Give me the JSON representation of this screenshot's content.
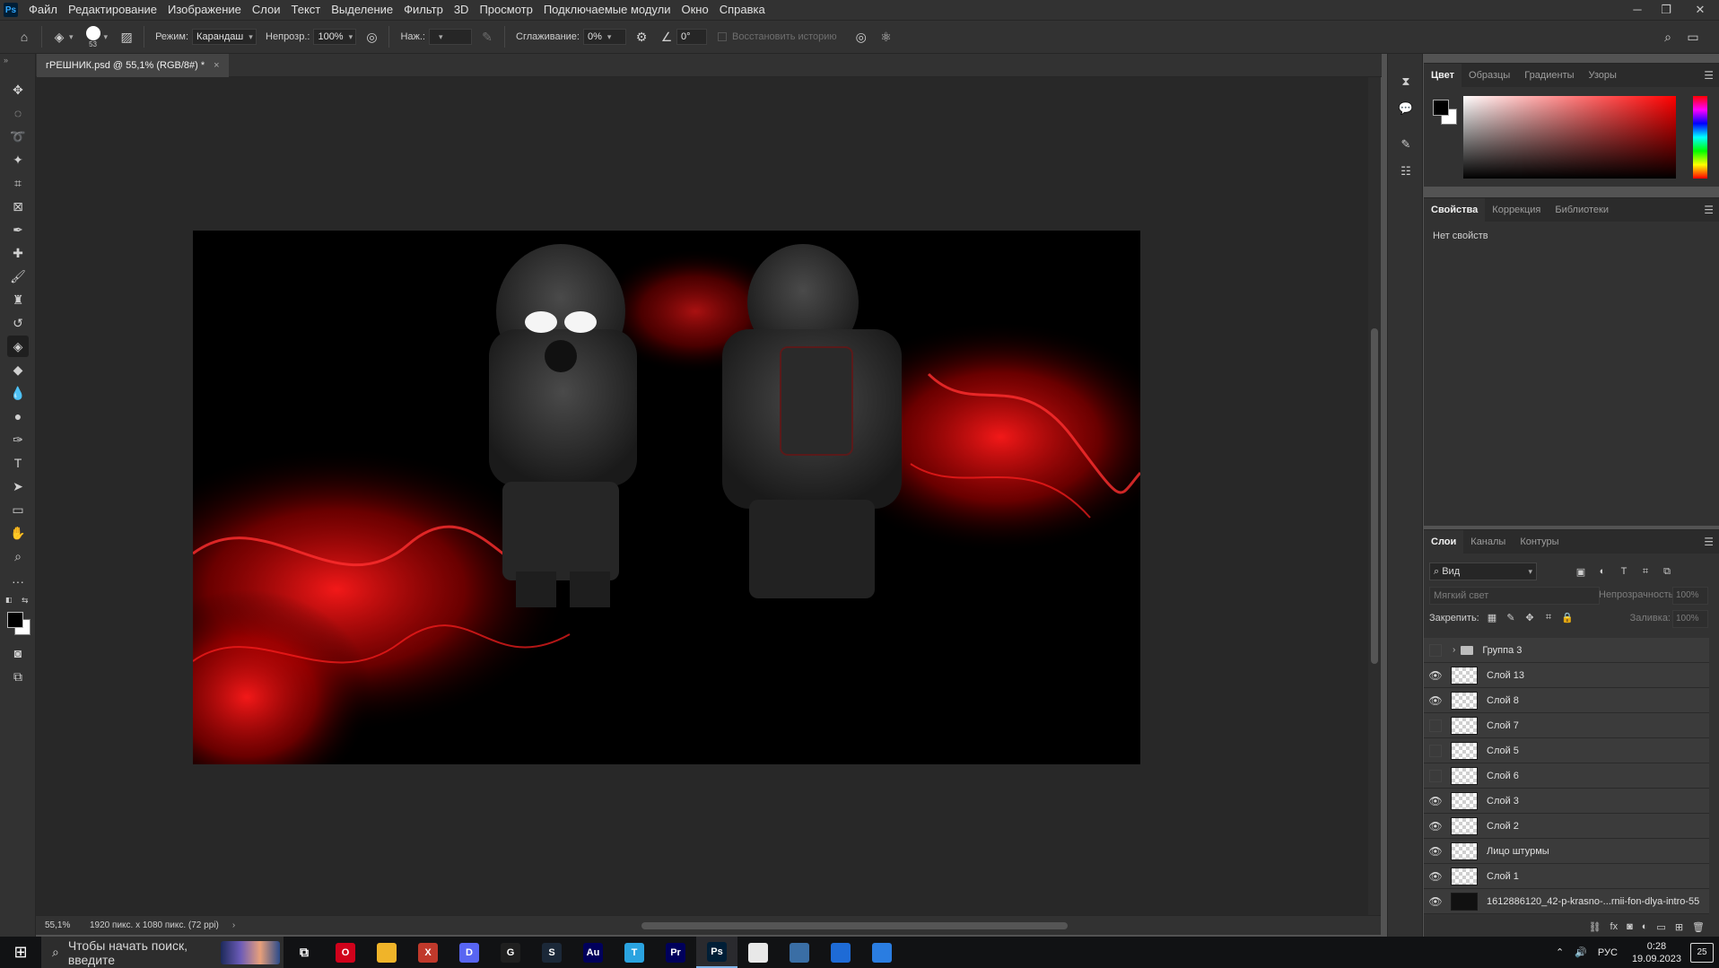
{
  "app": {
    "logo": "Ps"
  },
  "menu": [
    "Файл",
    "Редактирование",
    "Изображение",
    "Слои",
    "Текст",
    "Выделение",
    "Фильтр",
    "3D",
    "Просмотр",
    "Подключаемые модули",
    "Окно",
    "Справка"
  ],
  "options": {
    "brush_size": "53",
    "mode_label": "Режим:",
    "mode_value": "Карандаш",
    "opacity_label": "Непрозр.:",
    "opacity_value": "100%",
    "pressure_label": "Наж.:",
    "smoothing_label": "Сглаживание:",
    "smoothing_value": "0%",
    "angle_value": "0°",
    "restore_history": "Восстановить историю"
  },
  "document": {
    "tab_title": "гРЕШНИК.psd @ 55,1% (RGB/8#) *",
    "close_glyph": "×"
  },
  "status": {
    "zoom": "55,1%",
    "dimensions": "1920 пикс. x 1080 пикс. (72 ppi)"
  },
  "color_panel": {
    "tabs": [
      "Цвет",
      "Образцы",
      "Градиенты",
      "Узоры"
    ],
    "foreground": "#000000",
    "background": "#ffffff"
  },
  "properties_panel": {
    "tabs": [
      "Свойства",
      "Коррекция",
      "Библиотеки"
    ],
    "empty_text": "Нет свойств"
  },
  "layers_panel": {
    "tabs": [
      "Слои",
      "Каналы",
      "Контуры"
    ],
    "filter_value": "Вид",
    "blend_mode": "Мягкий свет",
    "opacity_label": "Непрозрачность:",
    "opacity_value": "100%",
    "lock_label": "Закрепить:",
    "fill_label": "Заливка:",
    "fill_value": "100%",
    "layers": [
      {
        "name": "Группа 3",
        "visible": false,
        "kind": "group"
      },
      {
        "name": "Слой 13",
        "visible": true,
        "kind": "layer"
      },
      {
        "name": "Слой 8",
        "visible": true,
        "kind": "layer"
      },
      {
        "name": "Слой 7",
        "visible": false,
        "kind": "layer"
      },
      {
        "name": "Слой 5",
        "visible": false,
        "kind": "layer"
      },
      {
        "name": "Слой 6",
        "visible": false,
        "kind": "layer"
      },
      {
        "name": "Слой 3",
        "visible": true,
        "kind": "layer"
      },
      {
        "name": "Слой 2",
        "visible": true,
        "kind": "layer"
      },
      {
        "name": "Лицо штурмы",
        "visible": true,
        "kind": "layer"
      },
      {
        "name": "Слой 1",
        "visible": true,
        "kind": "layer"
      },
      {
        "name": "1612886120_42-p-krasno-...rnii-fon-dlya-intro-55",
        "visible": true,
        "kind": "image"
      }
    ]
  },
  "taskbar": {
    "search_placeholder": "Чтобы начать поиск, введите",
    "language": "РУС",
    "time": "0:28",
    "date": "19.09.2023",
    "notifications": "25",
    "apps": [
      {
        "name": "opera",
        "label": "O",
        "color": "#d0021b"
      },
      {
        "name": "explorer",
        "label": "",
        "color": "#f0b429"
      },
      {
        "name": "app-x",
        "label": "X",
        "color": "#c0392b"
      },
      {
        "name": "discord",
        "label": "D",
        "color": "#5865f2"
      },
      {
        "name": "g-hub",
        "label": "G",
        "color": "#1f1f1f"
      },
      {
        "name": "steam",
        "label": "S",
        "color": "#1b2838"
      },
      {
        "name": "audition",
        "label": "Au",
        "color": "#00005b"
      },
      {
        "name": "telegram",
        "label": "T",
        "color": "#2aa3e0"
      },
      {
        "name": "premiere",
        "label": "Pr",
        "color": "#00005b"
      },
      {
        "name": "photoshop",
        "label": "Ps",
        "color": "#001e36"
      },
      {
        "name": "notepad",
        "label": "",
        "color": "#e8e8e8"
      },
      {
        "name": "calculator",
        "label": "",
        "color": "#3a6ea5"
      },
      {
        "name": "photos",
        "label": "",
        "color": "#1e6bd6"
      },
      {
        "name": "media-player",
        "label": "",
        "color": "#2a7de1"
      }
    ]
  }
}
